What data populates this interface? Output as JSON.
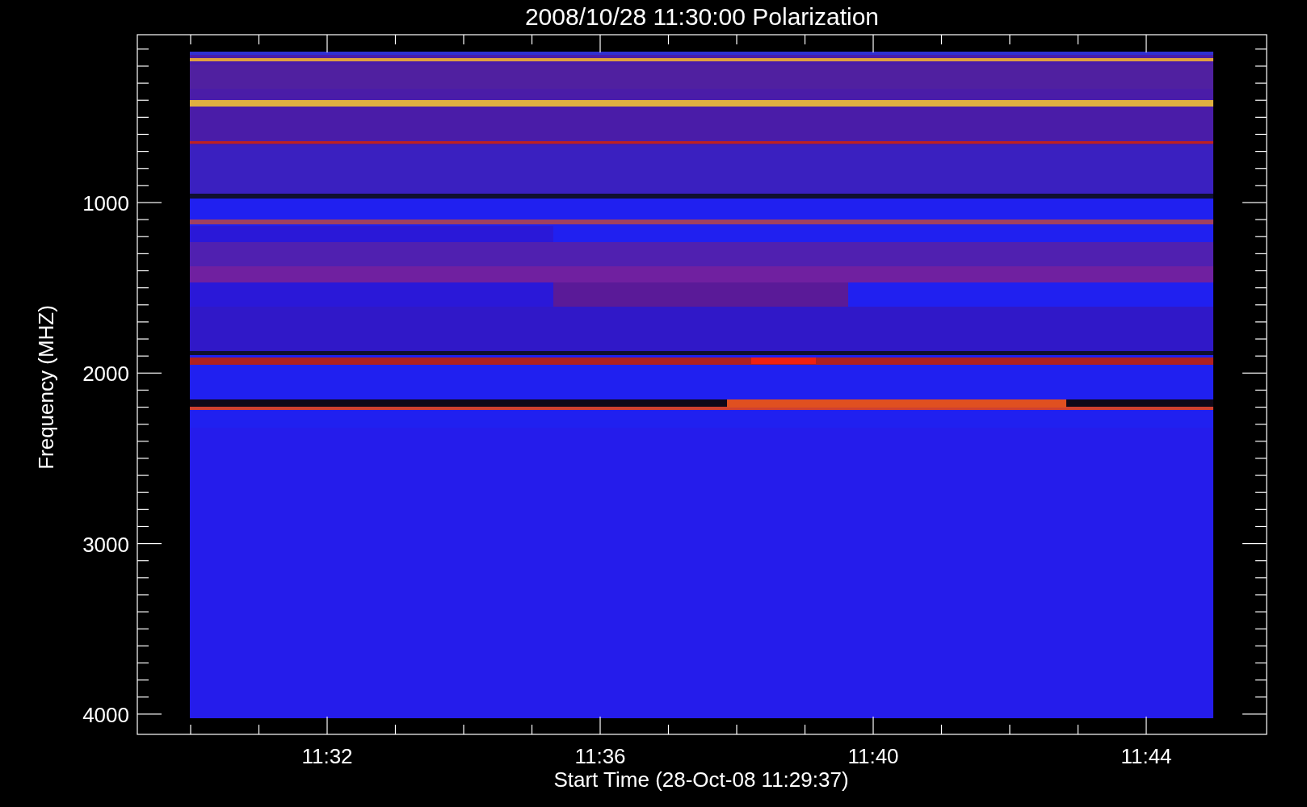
{
  "plot": {
    "title": "2008/10/28 11:30:00 Polarization",
    "ylabel": "Frequency (MHZ)",
    "xlabel": "Start Time (28-Oct-08 11:29:37)",
    "yticks": [
      "1000",
      "2000",
      "3000",
      "4000"
    ],
    "xticks": [
      "11:32",
      "11:36",
      "11:40",
      "11:44"
    ]
  }
}
